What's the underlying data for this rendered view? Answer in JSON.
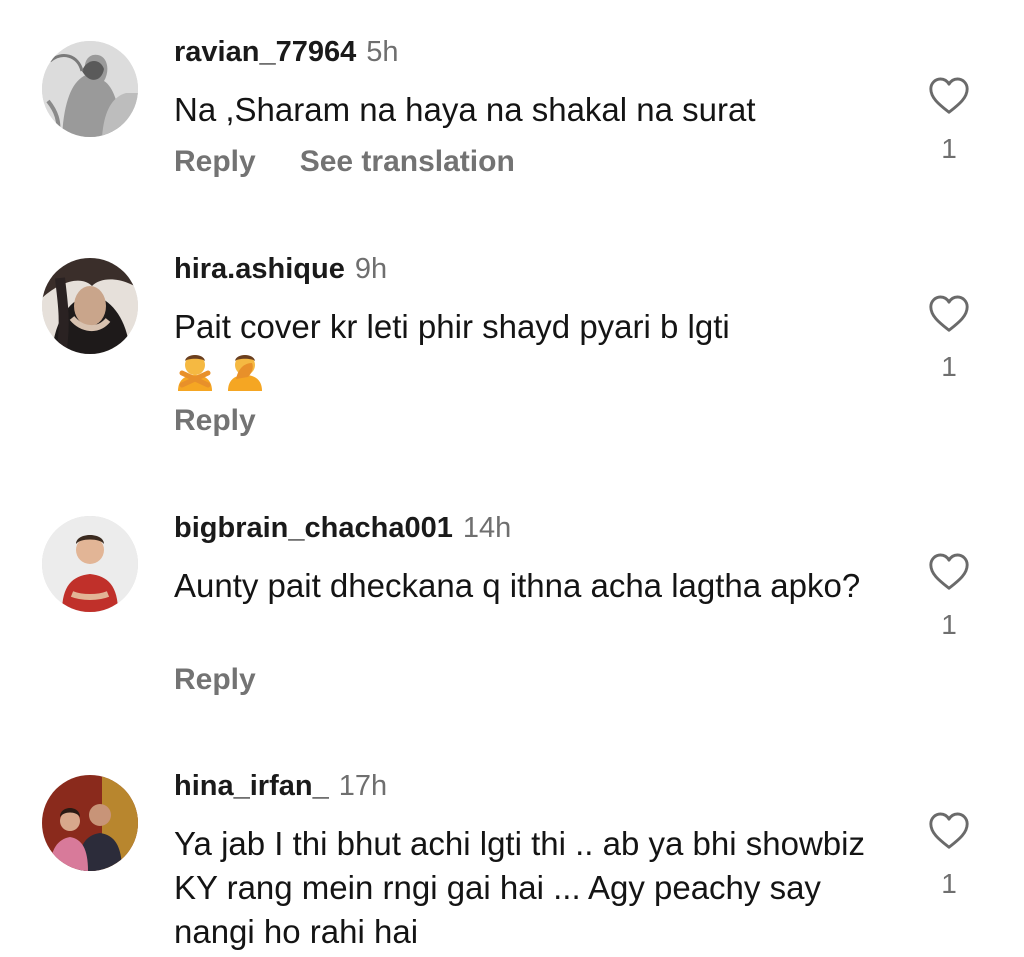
{
  "comments": [
    {
      "username": "ravian_77964",
      "time": "5h",
      "text": "Na ,Sharam na haya na shakal na surat",
      "reply_label": "Reply",
      "translation_label": "See translation",
      "likes": "1"
    },
    {
      "username": "hira.ashique",
      "time": "9h",
      "text": "Pait cover kr leti phir shayd pyari b lgti",
      "emojis": [
        "person-gesturing-no-emoji",
        "person-facepalming-emoji"
      ],
      "reply_label": "Reply",
      "likes": "1"
    },
    {
      "username": "bigbrain_chacha001",
      "time": "14h",
      "text": "Aunty pait dheckana q ithna acha lagtha apko?",
      "reply_label": "Reply",
      "likes": "1"
    },
    {
      "username": "hina_irfan_",
      "time": "17h",
      "text": "Ya jab I thi bhut achi lgti thi .. ab ya bhi showbiz KY rang mein rngi gai hai ... Agy peachy say nangi ho rahi hai",
      "likes": "1"
    }
  ],
  "icons": {
    "like": "heart-outline-icon"
  },
  "colors": {
    "username": "#1a1a1a",
    "meta": "#737373",
    "emoji": "#f5a623"
  }
}
